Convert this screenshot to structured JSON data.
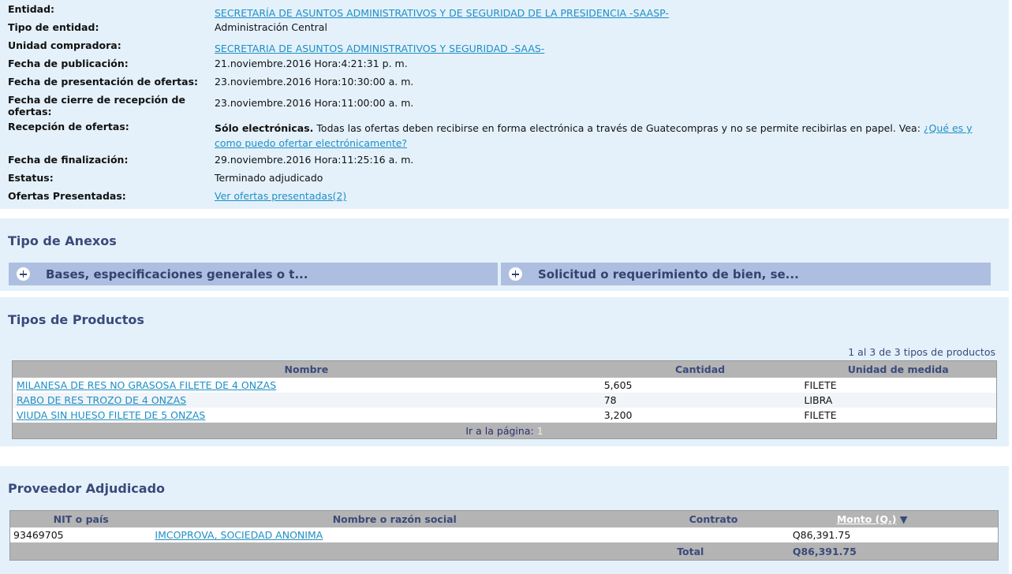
{
  "info": {
    "entidad": {
      "label": "Entidad:",
      "value": "SECRETARÍA DE ASUNTOS ADMINISTRATIVOS Y DE SEGURIDAD DE LA PRESIDENCIA -SAASP-"
    },
    "tipo_entidad": {
      "label": "Tipo de entidad:",
      "value": "Administración Central"
    },
    "unidad_compradora": {
      "label": "Unidad compradora:",
      "value": "SECRETARIA DE ASUNTOS ADMINISTRATIVOS Y SEGURIDAD -SAAS-"
    },
    "fecha_publicacion": {
      "label": "Fecha de publicación:",
      "value": "21.noviembre.2016 Hora:4:21:31 p. m."
    },
    "fecha_presentacion": {
      "label": "Fecha de presentación de ofertas:",
      "value": "23.noviembre.2016 Hora:10:30:00 a. m."
    },
    "fecha_cierre": {
      "label": "Fecha de cierre de recepción de ofertas:",
      "value": "23.noviembre.2016 Hora:11:00:00 a. m."
    },
    "recepcion": {
      "label": "Recepción de ofertas:",
      "bold": "Sólo electrónicas.",
      "text": "Todas las ofertas deben recibirse en forma electrónica a través de Guatecompras y no se permite recibirlas en papel. Vea:",
      "link": "¿Qué es y como puedo ofertar electrónicamente?"
    },
    "fecha_finalizacion": {
      "label": "Fecha de finalización:",
      "value": "29.noviembre.2016 Hora:11:25:16 a. m."
    },
    "estatus": {
      "label": "Estatus:",
      "value": "Terminado adjudicado"
    },
    "ofertas": {
      "label": "Ofertas Presentadas:",
      "value": "Ver ofertas presentadas(2)"
    }
  },
  "anexos": {
    "title": "Tipo de Anexos",
    "items": [
      {
        "label": "Bases, especificaciones generales o t..."
      },
      {
        "label": "Solicitud o requerimiento de bien, se..."
      }
    ]
  },
  "productos": {
    "title": "Tipos de Productos",
    "count_text": "1 al 3 de 3 tipos de productos",
    "headers": {
      "nombre": "Nombre",
      "cantidad": "Cantidad",
      "unidad": "Unidad de medida"
    },
    "rows": [
      {
        "nombre": "MILANESA DE RES NO GRASOSA FILETE DE 4 ONZAS",
        "cantidad": "5,605",
        "unidad": "FILETE"
      },
      {
        "nombre": "RABO DE RES TROZO DE 4 ONZAS",
        "cantidad": "78",
        "unidad": "LIBRA"
      },
      {
        "nombre": "VIUDA SIN HUESO FILETE DE 5 ONZAS",
        "cantidad": "3,200",
        "unidad": "FILETE"
      }
    ],
    "pager_label": "Ir a la página:",
    "pager_current": "1"
  },
  "proveedor": {
    "title": "Proveedor Adjudicado",
    "headers": {
      "nit": "NIT o país",
      "nombre": "Nombre o razón social",
      "contrato": "Contrato",
      "monto": "Monto (Q.)",
      "sort_indicator": "▼"
    },
    "rows": [
      {
        "nit": "93469705",
        "nombre": "IMCOPROVA, SOCIEDAD ANONIMA",
        "contrato": "",
        "monto": "Q86,391.75"
      }
    ],
    "total_label": "Total",
    "total_value": "Q86,391.75"
  }
}
